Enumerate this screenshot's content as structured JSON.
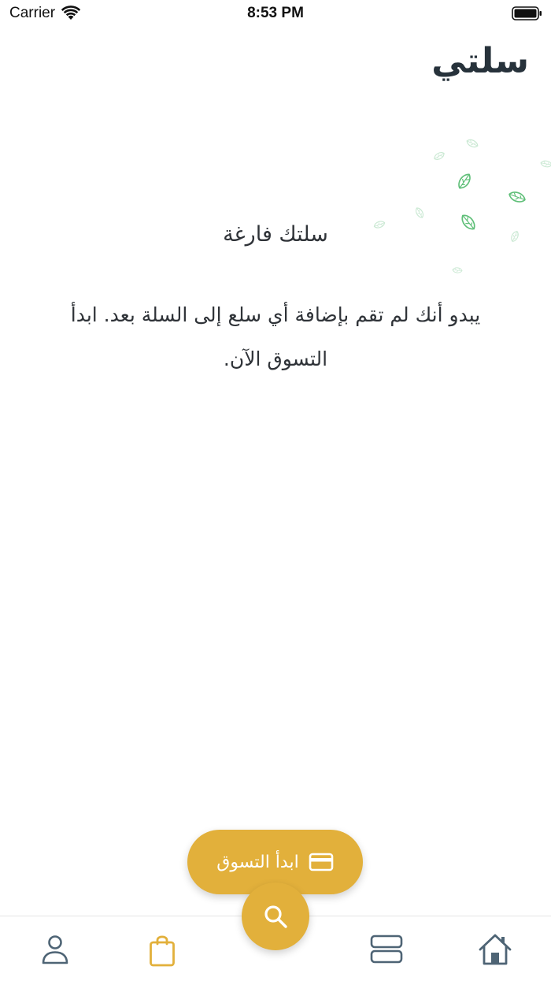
{
  "status_bar": {
    "carrier": "Carrier",
    "time": "8:53 PM"
  },
  "page": {
    "title": "سلتي"
  },
  "empty_state": {
    "title": "سلتك فارغة",
    "message": "يبدو أنك لم تقم بإضافة أي سلع إلى السلة بعد. ابدأ التسوق الآن."
  },
  "actions": {
    "start_shopping_label": "ابدأ التسوق"
  },
  "icons": {
    "card": "credit-card-icon",
    "search": "search-icon",
    "profile": "user-icon",
    "cart": "shopping-bag-icon",
    "categories": "rows-icon",
    "home": "home-icon",
    "leaves": "leaf-icon"
  },
  "colors": {
    "accent": "#e2b03b",
    "nav_icon": "#4e6475",
    "leaf_strong": "#5fbf78",
    "leaf_faint": "#c9e8d2",
    "title_text": "#27323b",
    "body_text": "#2f3338"
  }
}
